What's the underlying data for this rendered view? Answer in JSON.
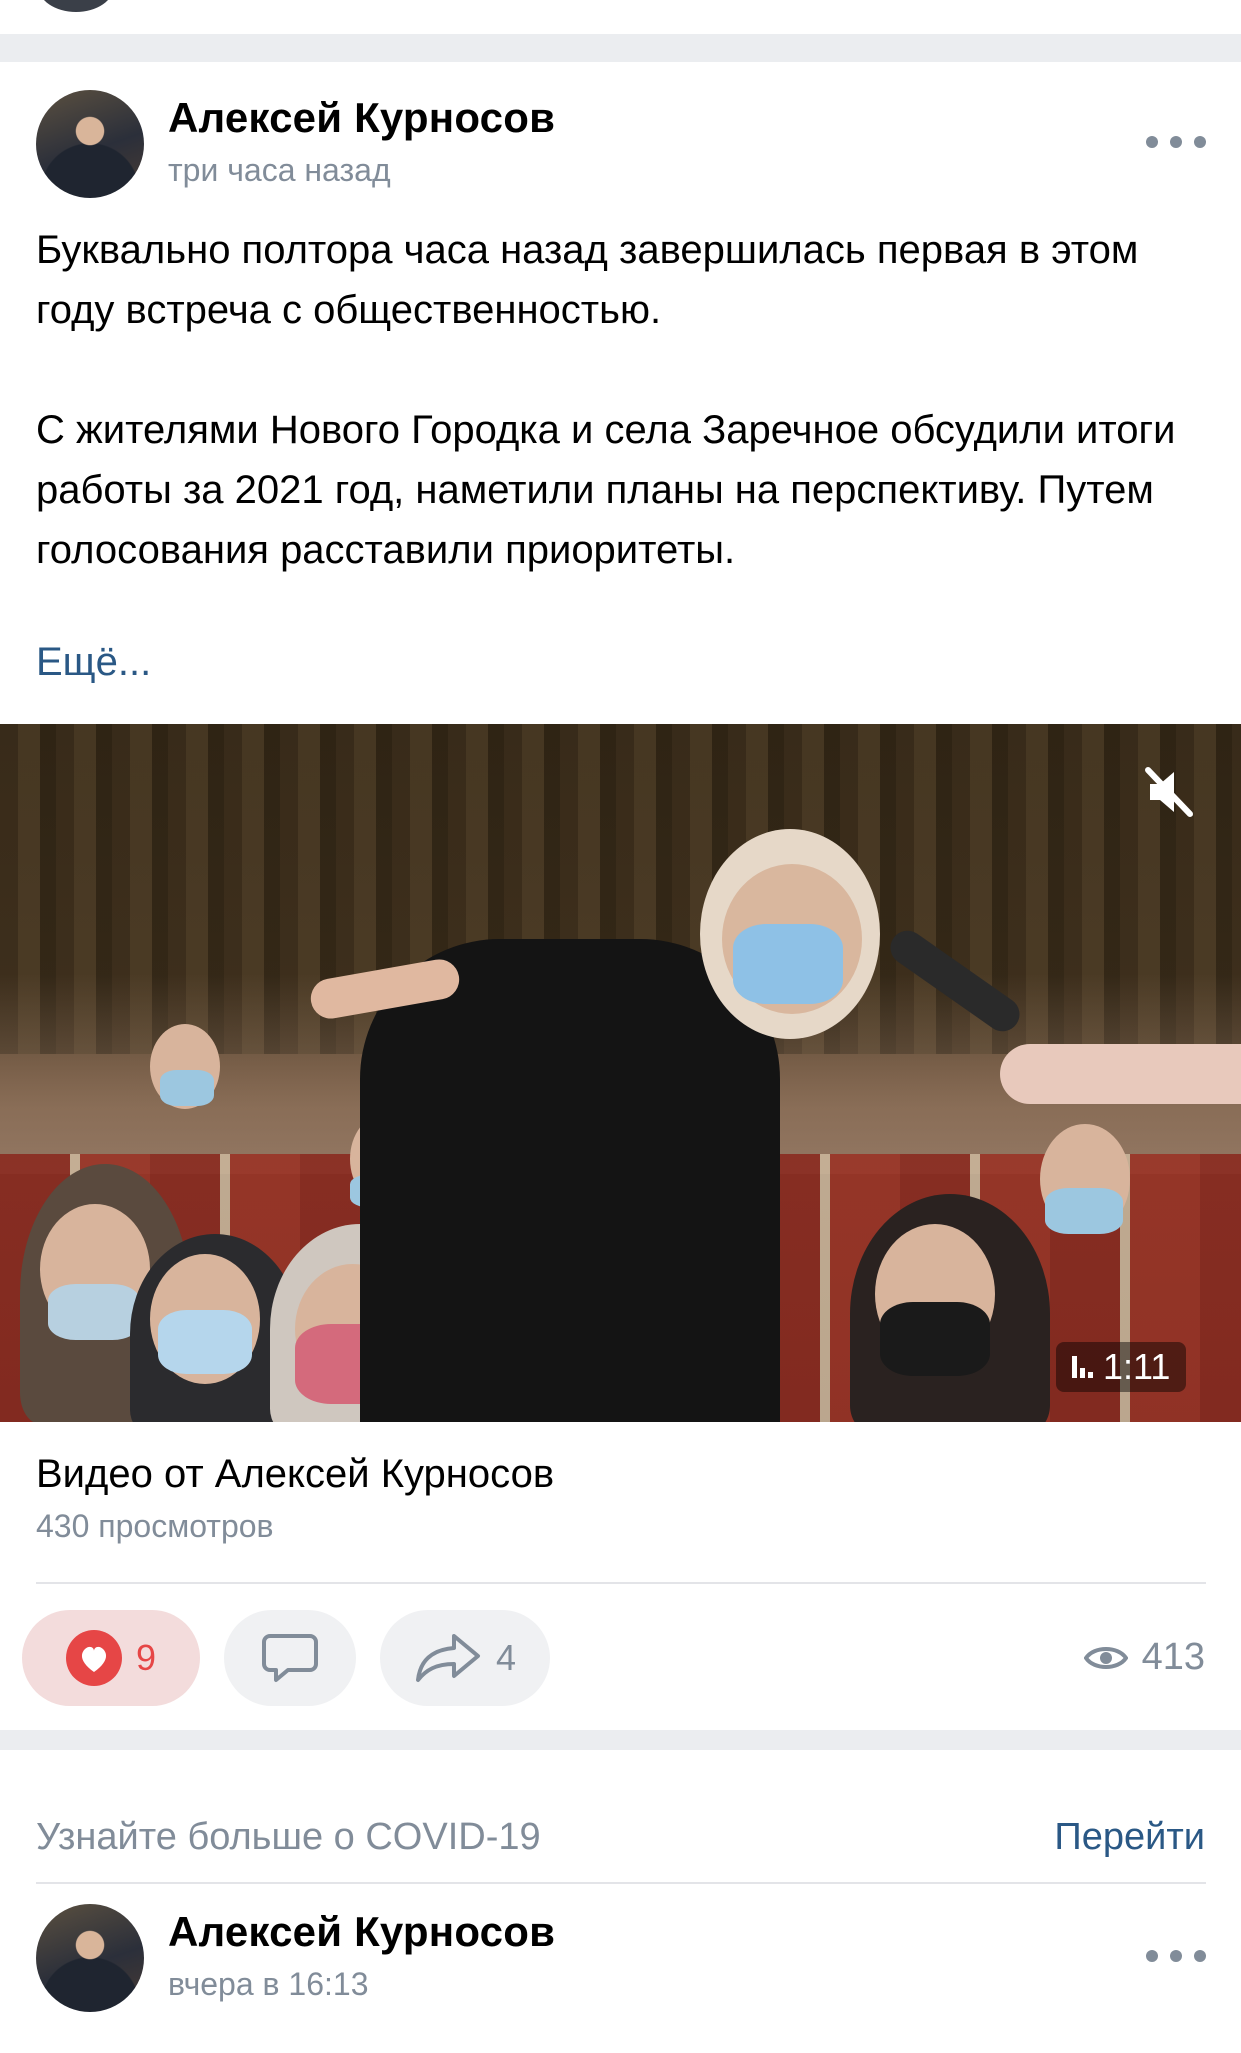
{
  "post": {
    "author": "Алексей Курносов",
    "time": "три часа назад",
    "paragraphs": [
      "Буквально полтора часа назад завершилась первая в этом году встреча с общественностью.",
      "С жителями Нового Городка и села Заречное обсудили итоги работы за 2021 год, наметили планы на перспективу. Путем голосования расставили приоритеты."
    ],
    "more_label": "Ещё...",
    "video": {
      "duration": "1:11",
      "title": "Видео от Алексей Курносов",
      "views": "430 просмотров"
    },
    "actions": {
      "likes": "9",
      "shares": "4",
      "views": "413"
    },
    "colors": {
      "like_accent": "#e64646",
      "link": "#2a5885",
      "secondary_text": "#818c99"
    }
  },
  "covid_banner": {
    "text": "Узнайте больше о COVID-19",
    "link": "Перейти"
  },
  "next_post": {
    "author": "Алексей Курносов",
    "time": "вчера в 16:13"
  },
  "icons": {
    "more": "more-horizontal-icon",
    "mute": "volume-muted-icon",
    "like": "heart-icon",
    "comment": "comment-icon",
    "share": "share-arrow-icon",
    "views": "eye-icon"
  }
}
